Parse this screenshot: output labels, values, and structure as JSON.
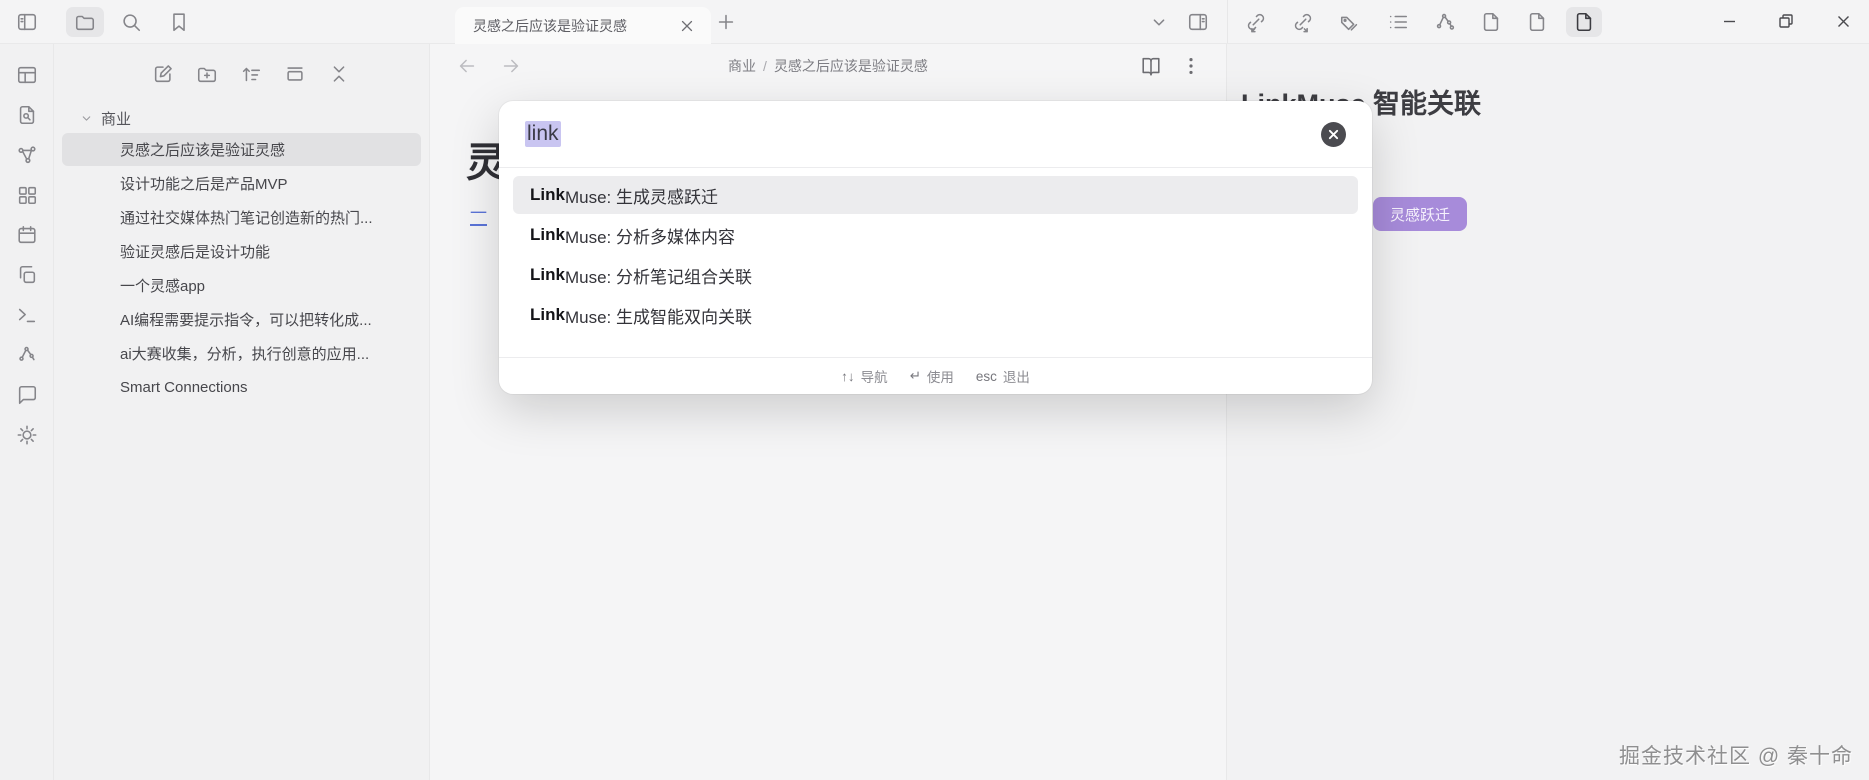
{
  "colors": {
    "accent_purple": "#a78bda",
    "query_selection": "#c9c5f1",
    "active_row": "#ececee"
  },
  "top_bar": {
    "tab": {
      "title": "灵感之后应该是验证灵感"
    },
    "icons_left": [
      "panel-left-toggle",
      "folder",
      "search",
      "bookmark"
    ],
    "icons_right": [
      "chevron-down",
      "panel-right",
      "link-in",
      "link-out",
      "tags",
      "list",
      "graph",
      "file",
      "file",
      "file-active"
    ],
    "window_controls": [
      "minimize",
      "restore",
      "close"
    ]
  },
  "ribbon": {
    "icons": [
      "panel-layout",
      "file-search",
      "graph-fork",
      "dashboard-grid",
      "calendar",
      "copy",
      "terminal",
      "smart-connections",
      "comments",
      "settings"
    ]
  },
  "explorer": {
    "toolbar_icons": [
      "new-note",
      "new-folder",
      "sort",
      "stack",
      "collapse-all"
    ],
    "folder": {
      "label": "商业"
    },
    "files": [
      {
        "label": "灵感之后应该是验证灵感",
        "selected": true
      },
      {
        "label": "设计功能之后是产品MVP",
        "selected": false
      },
      {
        "label": "通过社交媒体热门笔记创造新的热门...",
        "selected": false
      },
      {
        "label": "验证灵感后是设计功能",
        "selected": false
      },
      {
        "label": "一个灵感app",
        "selected": false
      },
      {
        "label": "AI编程需要提示指令，可以把转化成...",
        "selected": false
      },
      {
        "label": "ai大赛收集，分析，执行创意的应用...",
        "selected": false
      },
      {
        "label": "Smart Connections",
        "selected": false
      }
    ]
  },
  "editor": {
    "breadcrumb": {
      "folder": "商业",
      "separator": "/",
      "note": "灵感之后应该是验证灵感"
    },
    "heading_fragment": "灵",
    "link_fragment": "一"
  },
  "right_panel": {
    "heading": "LinkMuse 智能关联",
    "jump_button": "灵感跃迁",
    "watermark": "掘金技术社区 @ 秦十命"
  },
  "palette": {
    "query": "link",
    "results": [
      {
        "prefix": "Link",
        "rest": "Muse: 生成灵感跃迁",
        "active": true
      },
      {
        "prefix": "Link",
        "rest": "Muse: 分析多媒体内容",
        "active": false
      },
      {
        "prefix": "Link",
        "rest": "Muse: 分析笔记组合关联",
        "active": false
      },
      {
        "prefix": "Link",
        "rest": "Muse: 生成智能双向关联",
        "active": false
      }
    ],
    "footer": {
      "nav_key": "↑↓",
      "nav_label": "导航",
      "use_key": "↵",
      "use_label": "使用",
      "esc_key": "esc",
      "esc_label": "退出"
    }
  }
}
